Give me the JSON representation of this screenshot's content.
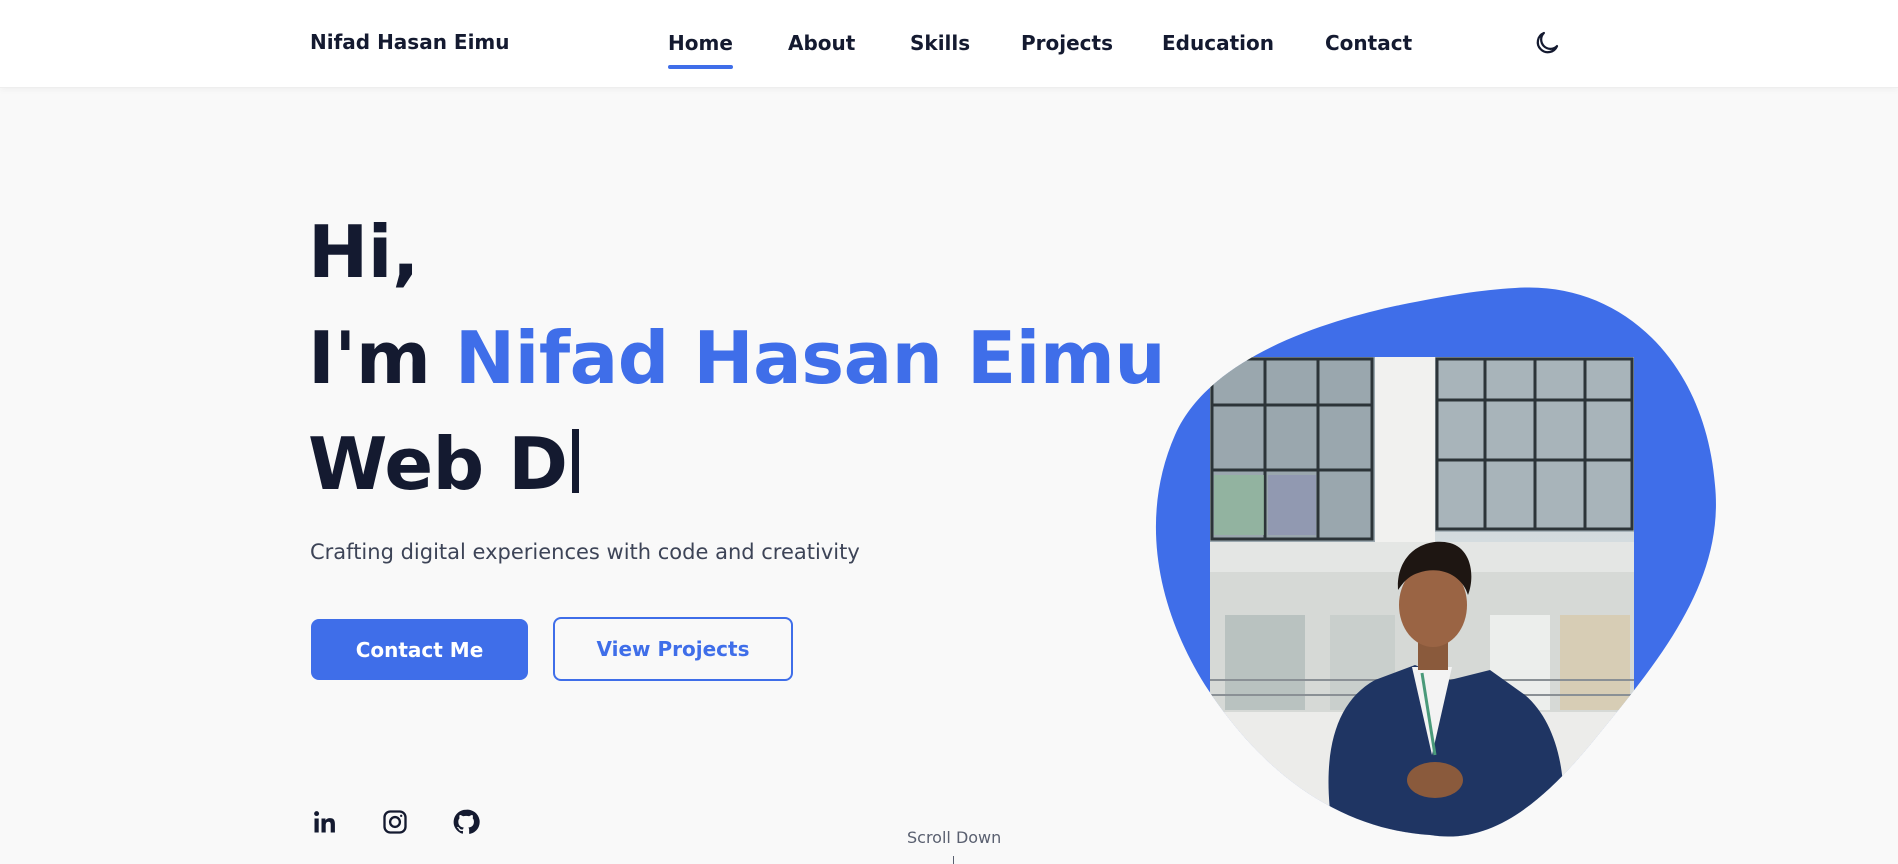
{
  "brand": "Nifad Hasan Eimu",
  "nav": {
    "items": [
      "Home",
      "About",
      "Skills",
      "Projects",
      "Education",
      "Contact"
    ],
    "active": "Home",
    "theme_toggle_icon": "moon-icon"
  },
  "hero": {
    "greeting": "Hi,",
    "intro_prefix": "I'm ",
    "name": "Nifad Hasan Eimu",
    "typed_text": "Web D",
    "tagline": "Crafting digital experiences with code and creativity",
    "primary_button": "Contact Me",
    "secondary_button": "View Projects",
    "portrait_icon": "profile-photo"
  },
  "social": [
    {
      "icon": "linkedin-icon"
    },
    {
      "icon": "instagram-icon"
    },
    {
      "icon": "github-icon"
    }
  ],
  "scroll_hint": "Scroll Down",
  "colors": {
    "accent": "#3f6ee9",
    "text_dark": "#141a30",
    "background": "#f9f9f9"
  }
}
